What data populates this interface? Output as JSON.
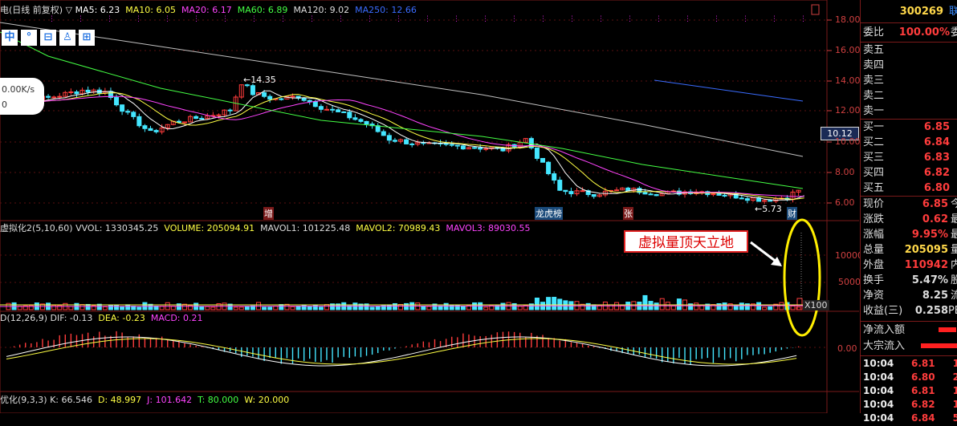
{
  "chart_header": {
    "title": "电(日线 前复权)",
    "ma5": "MA5: 6.23",
    "ma10": "MA10: 6.05",
    "ma20": "MA20: 6.17",
    "ma60": "MA60: 6.89",
    "ma120": "MA120: 9.02",
    "ma250": "MA250: 12.66"
  },
  "vol_header": {
    "title": "虚拟化2(5,10,60)",
    "vvol": "VVOL: 1330345.25",
    "volume": "VOLUME: 205094.91",
    "mavol1": "MAVOL1: 101225.48",
    "mavol2": "MAVOL2: 70989.43",
    "mavol3": "MAVOL3: 89030.55"
  },
  "macd_header": {
    "title": "D(12,26,9)",
    "dif": "DIF: -0.13",
    "dea": "DEA: -0.23",
    "macd": "MACD: 0.21"
  },
  "kdj_header": {
    "title": "优化(9,3,3)",
    "k": "K: 66.546",
    "d": "D: 48.997",
    "j": "J: 101.642",
    "t": "T: 80.000",
    "w": "W: 20.000"
  },
  "toolbar": [
    "中",
    "°",
    "⊟",
    "♙",
    "⊞"
  ],
  "speed_widget": {
    "rate": "0.00K/s",
    "count": "0"
  },
  "price_annotations": {
    "high": "14.35",
    "low": "5.73",
    "current_price_box": "10.12"
  },
  "event_markers": [
    "增",
    "龙虎榜",
    "张",
    "财"
  ],
  "callout": "虚拟量顶天立地",
  "axis_labels": {
    "price": [
      "18.00",
      "16.00",
      "14.00",
      "12.00",
      "10.00",
      "8.00",
      "6.00"
    ],
    "volume": [
      "10000",
      "5000",
      "X100"
    ],
    "macd": [
      "0.00"
    ]
  },
  "sidebar": {
    "code": "300269",
    "name_partial": "联",
    "weibi_label": "委比",
    "weibi_value": "100.00%",
    "weibi_extra": "委",
    "sell": [
      "卖五",
      "卖四",
      "卖三",
      "卖二",
      "卖一"
    ],
    "buy": [
      {
        "label": "买一",
        "price": "6.85"
      },
      {
        "label": "买二",
        "price": "6.84"
      },
      {
        "label": "买三",
        "price": "6.83"
      },
      {
        "label": "买四",
        "price": "6.82"
      },
      {
        "label": "买五",
        "price": "6.80"
      }
    ],
    "stats": [
      {
        "label": "现价",
        "value": "6.85",
        "extra": "今",
        "color": "#ff3c3c"
      },
      {
        "label": "涨跌",
        "value": "0.62",
        "extra": "最",
        "color": "#ff3c3c"
      },
      {
        "label": "涨幅",
        "value": "9.95%",
        "extra": "最",
        "color": "#ff3c3c"
      },
      {
        "label": "总量",
        "value": "205095",
        "extra": "量",
        "color": "#ffd84a"
      },
      {
        "label": "外盘",
        "value": "110942",
        "extra": "内",
        "color": "#ff3c3c"
      },
      {
        "label": "换手",
        "value": "5.47%",
        "extra": "股",
        "color": "#dddddd"
      },
      {
        "label": "净资",
        "value": "8.25",
        "extra": "流",
        "color": "#dddddd"
      },
      {
        "label": "收益(三)",
        "value": "0.258",
        "extra": "PE",
        "color": "#dddddd"
      }
    ],
    "flows": [
      {
        "label": "净流入额"
      },
      {
        "label": "大宗流入"
      }
    ],
    "ticks": [
      {
        "time": "10:04",
        "price": "6.81",
        "qty": "1"
      },
      {
        "time": "10:04",
        "price": "6.80",
        "qty": "2"
      },
      {
        "time": "10:04",
        "price": "6.81",
        "qty": "1"
      },
      {
        "time": "10:04",
        "price": "6.82",
        "qty": "1"
      },
      {
        "time": "10:04",
        "price": "6.84",
        "qty": "5"
      }
    ]
  },
  "colors": {
    "background": "#000000",
    "up": "#ff3c3c",
    "down": "#44e6ff",
    "ma5": "#ffffff",
    "ma10": "#ffff44",
    "ma20": "#ff44ff",
    "ma60": "#44ff44",
    "ma120": "#c0c0c0",
    "ma250": "#3a6cff",
    "grid": "#7a1a1a"
  }
}
